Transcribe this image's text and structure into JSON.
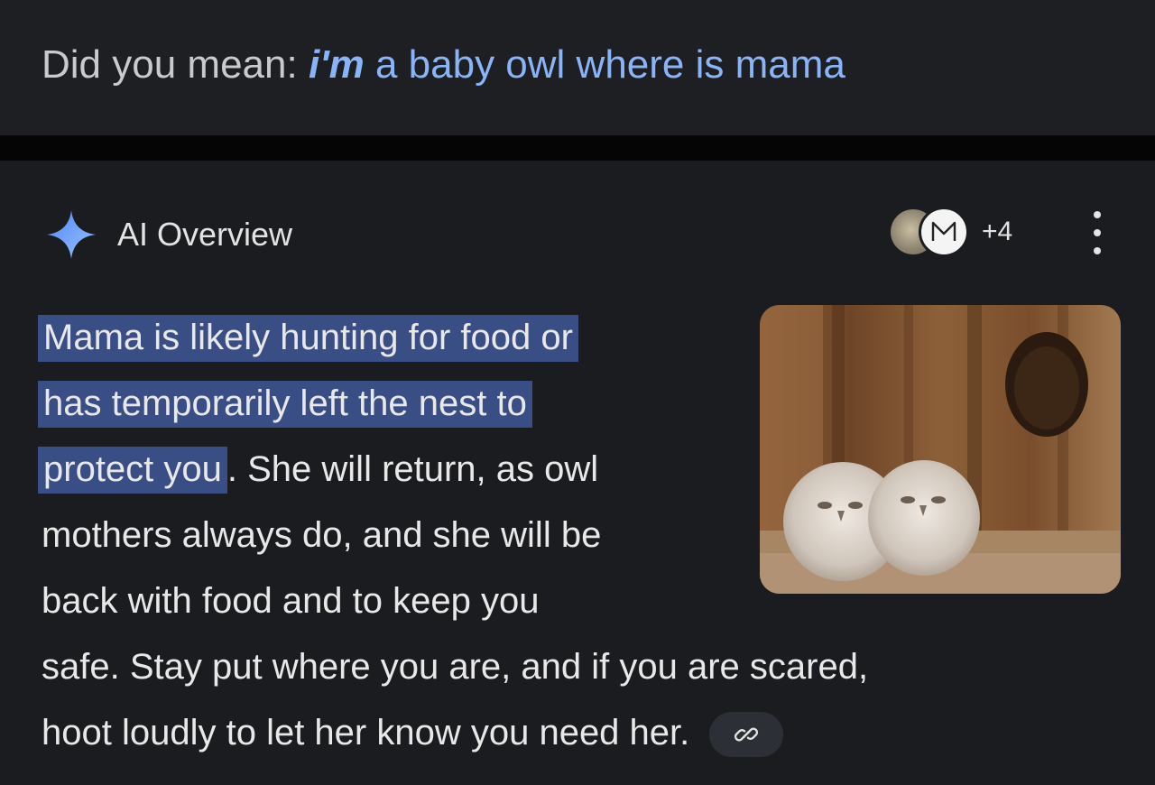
{
  "spelling_suggestion": {
    "prefix": "Did you mean: ",
    "corrected_word": "i'm",
    "rest": " a baby owl where is mama"
  },
  "ai_overview": {
    "title": "AI Overview",
    "source_count": "+4",
    "answer": {
      "highlighted_1": "Mama is likely hunting for food or",
      "highlighted_2": "has temporarily left the nest to",
      "highlighted_3": "protect you",
      "line_3_rest": ". She will return, as owl",
      "line_4": "mothers always do, and she will be",
      "line_5": "back with food and to keep you",
      "line_6": "safe. Stay put where you are, and if you are scared,",
      "line_7": "hoot loudly to let her know you need her."
    },
    "icons": {
      "header": "sparkle-icon",
      "menu": "more-vert-icon",
      "citation": "link-icon"
    }
  },
  "colors": {
    "accent_link": "#8ab4f8",
    "highlight": "#3a4e86",
    "background": "#1b1c1f"
  }
}
